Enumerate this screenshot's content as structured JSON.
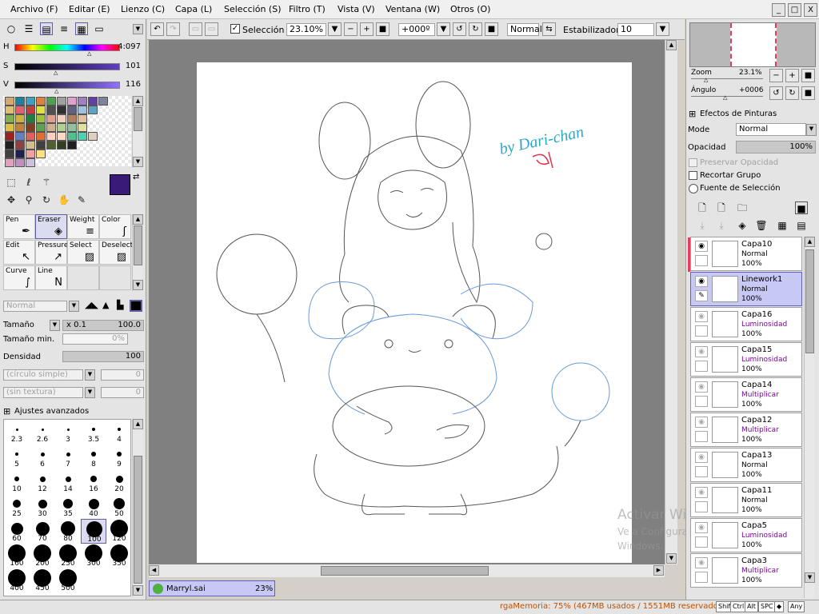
{
  "menu": [
    "Archivo (F)",
    "Editar (E)",
    "Lienzo (C)",
    "Capa (L)",
    "Selección (S)",
    "Filtro (T)",
    "Vista (V)",
    "Ventana (W)",
    "Otros (O)"
  ],
  "window_buttons": [
    "_",
    "□",
    "X"
  ],
  "color": {
    "h_label": "H",
    "h_value": "4:097",
    "s_label": "S",
    "s_value": "101",
    "v_label": "V",
    "v_value": "116",
    "primary": "#3a1a78"
  },
  "palette": [
    "#d4a870",
    "#2080a0",
    "#40a0c0",
    "#e08040",
    "#50a050",
    "#a0a0a0",
    "#e0a0d0",
    "#a080c0",
    "#6040a0",
    "#8080a0",
    "#e0c070",
    "#e06070",
    "#c04040",
    "#e0e040",
    "#505050",
    "#303030",
    "#606080",
    "#a0c0e0",
    "#60a0c0",
    "",
    "#80b050",
    "#d0b040",
    "#208040",
    "#a0c040",
    "#e0a090",
    "#f0d0c0",
    "#b08060",
    "#e0c0a0",
    "",
    "",
    "#e0c040",
    "#c08040",
    "#804020",
    "#60a050",
    "#d0b090",
    "#b0d090",
    "#90c0a0",
    "#e0e0a0",
    "",
    "",
    "#a02020",
    "#6080c0",
    "#e06060",
    "#e07030",
    "#ffd0c0",
    "#ffd8c8",
    "#50c090",
    "#50d0b0",
    "#e0d0c0",
    "",
    "#202020",
    "#904040",
    "#d0c090",
    "#404040",
    "#506030",
    "#304020",
    "#202020",
    "",
    "",
    "",
    "#404040",
    "#202050",
    "#f0a0a0",
    "#ffe080",
    "",
    "",
    "",
    "",
    "",
    "",
    "#e0a0c0",
    "#c090c0",
    "#d0c0e0",
    "",
    "",
    "",
    "",
    "",
    "",
    ""
  ],
  "brush_tools": [
    {
      "label": "Pen",
      "icon": "pen-icon",
      "glyph": "✒"
    },
    {
      "label": "Eraser",
      "icon": "eraser-icon",
      "glyph": "◈"
    },
    {
      "label": "Weight",
      "icon": "weight-icon",
      "glyph": "≡"
    },
    {
      "label": "Color",
      "icon": "color-brush-icon",
      "glyph": "ʃ"
    },
    {
      "label": "Edit",
      "icon": "edit-icon",
      "glyph": "↖"
    },
    {
      "label": "Pressure",
      "icon": "pressure-icon",
      "glyph": "↗"
    },
    {
      "label": "Select",
      "icon": "select-icon",
      "glyph": "▨"
    },
    {
      "label": "Deselect",
      "icon": "deselect-icon",
      "glyph": "▨"
    },
    {
      "label": "Curve",
      "icon": "curve-icon",
      "glyph": "∫"
    },
    {
      "label": "Line",
      "icon": "line-icon",
      "glyph": "N"
    }
  ],
  "brush": {
    "mode": "Normal",
    "size_label": "Tamaño",
    "size_mult": "x 0.1",
    "size_value": "100.0",
    "minsize_label": "Tamaño min.",
    "minsize_value": "0%",
    "density_label": "Densidad",
    "density_value": "100",
    "shape": "(círculo simple)",
    "shape_value": "0",
    "texture": "(sin textura)",
    "texture_value": "0",
    "advanced_label": "Ajustes avanzados"
  },
  "brush_sizes": [
    [
      "2.3",
      "2.6",
      "3",
      "3.5",
      "4"
    ],
    [
      "5",
      "6",
      "7",
      "8",
      "9"
    ],
    [
      "10",
      "12",
      "14",
      "16",
      "20"
    ],
    [
      "25",
      "30",
      "35",
      "40",
      "50"
    ],
    [
      "60",
      "70",
      "80",
      "100",
      "120"
    ],
    [
      "160",
      "200",
      "250",
      "300",
      "350"
    ],
    [
      "400",
      "450",
      "500"
    ]
  ],
  "toolbar": {
    "selection_label": "Selección",
    "zoom": "23.10%",
    "angle": "+000º",
    "blend": "Normal",
    "stabilizer_label": "Estabilizador",
    "stabilizer_value": "10"
  },
  "navigator": {
    "zoom_label": "Zoom",
    "zoom_value": "23.1%",
    "angle_label": "Ángulo",
    "angle_value": "+0006"
  },
  "layer_props": {
    "effects_label": "Efectos de Pinturas",
    "mode_label": "Mode",
    "mode_value": "Normal",
    "opacity_label": "Opacidad",
    "opacity_value": "100%",
    "preserve_label": "Preservar Opacidad",
    "clip_label": "Recortar Grupo",
    "source_label": "Fuente de Selección"
  },
  "layers": [
    {
      "name": "Capa10",
      "mode": "Normal",
      "opacity": "100%",
      "mode_color": "#000000"
    },
    {
      "name": "Linework1",
      "mode": "Normal",
      "opacity": "100%",
      "mode_color": "#000000"
    },
    {
      "name": "Capa16",
      "mode": "Luminosidad",
      "opacity": "100%",
      "mode_color": "#8000a0"
    },
    {
      "name": "Capa15",
      "mode": "Luminosidad",
      "opacity": "100%",
      "mode_color": "#8000a0"
    },
    {
      "name": "Capa14",
      "mode": "Multiplicar",
      "opacity": "100%",
      "mode_color": "#8000a0"
    },
    {
      "name": "Capa12",
      "mode": "Multiplicar",
      "opacity": "100%",
      "mode_color": "#8000a0"
    },
    {
      "name": "Capa13",
      "mode": "Normal",
      "opacity": "100%",
      "mode_color": "#000000"
    },
    {
      "name": "Capa11",
      "mode": "Normal",
      "opacity": "100%",
      "mode_color": "#000000"
    },
    {
      "name": "Capa5",
      "mode": "Luminosidad",
      "opacity": "100%",
      "mode_color": "#8000a0"
    },
    {
      "name": "Capa3",
      "mode": "Multiplicar",
      "opacity": "100%",
      "mode_color": "#8000a0"
    }
  ],
  "document_tab": {
    "name": "Marryl.sai",
    "zoom": "23%"
  },
  "canvas_text": {
    "signature": "by Dari-chan"
  },
  "watermark": {
    "line1": "Activar Windows",
    "line2": "Ve a Configuración para activar",
    "line3": "Windows."
  },
  "status": {
    "memory": "rgaMemoria: 75% (467MB usados / 1551MB reservados)",
    "keys": [
      "Shift",
      "Ctrl",
      "Alt",
      "SPC",
      "◆",
      "Any"
    ]
  }
}
